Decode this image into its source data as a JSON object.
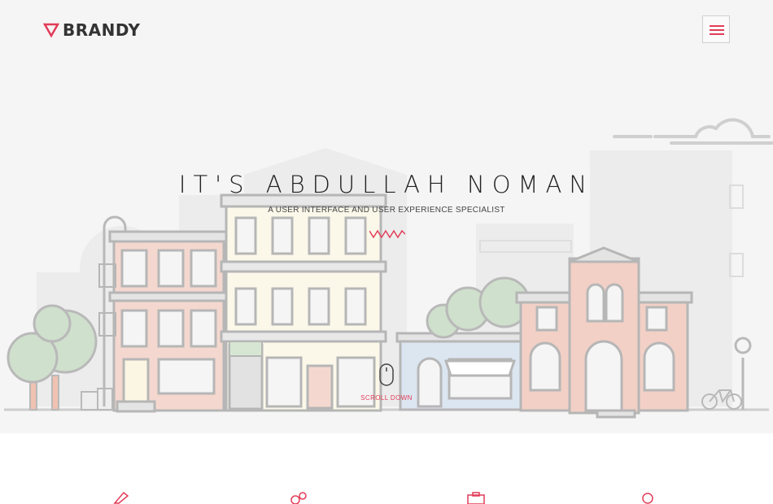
{
  "brand": {
    "name": "BRANDY",
    "accent": "#e23c58"
  },
  "header": {
    "menu_icon": "hamburger-icon"
  },
  "hero": {
    "title": "IT'S ABDULLAH NOMAN",
    "subtitle": "A USER INTERFACE AND USER EXPERIENCE SPECIALIST",
    "scroll_label": "SCROLL DOWN",
    "background": "#f5f5f5"
  },
  "services": {
    "icons": [
      "pencil-icon",
      "gears-icon",
      "camera-icon",
      "search-icon"
    ]
  }
}
